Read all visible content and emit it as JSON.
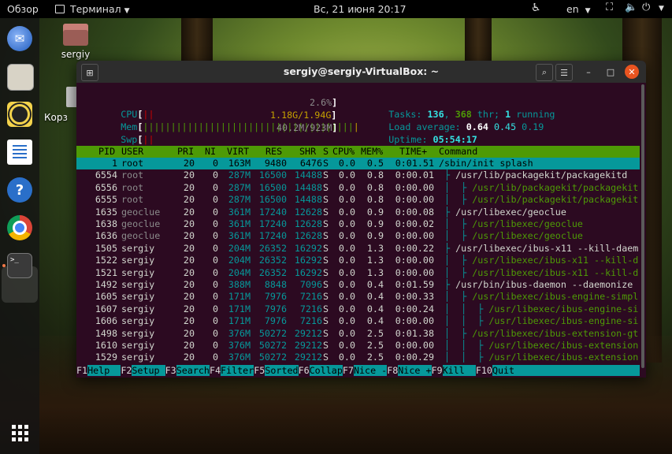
{
  "topbar": {
    "activities": "Обзор",
    "app_menu": "Терминал",
    "clock": "Вс, 21 июня  20:17",
    "language": "en"
  },
  "desktop": {
    "home_label": "sergiy",
    "trash_label": "Корз"
  },
  "window": {
    "title": "sergiy@sergiy-VirtualBox: ~"
  },
  "htop": {
    "meters": {
      "cpu_label": "CPU",
      "cpu_bar": "||",
      "cpu_value": "2.6%",
      "mem_label": "Mem",
      "mem_bar": "||||||||||||||||||||||||||||||||||||||",
      "mem_value": "1.18G/1.94G",
      "swp_label": "Swp",
      "swp_bar": "||",
      "swp_value": "40.2M/923M"
    },
    "summary": {
      "tasks_label": "Tasks:",
      "tasks": "136",
      "thr": "368",
      "thr_label": "thr;",
      "running": "1",
      "running_label": "running",
      "load_label": "Load average:",
      "load1": "0.64",
      "load5": "0.45",
      "load15": "0.19",
      "uptime_label": "Uptime:",
      "uptime": "05:54:17"
    },
    "header": [
      "PID",
      "USER",
      "PRI",
      "NI",
      "VIRT",
      "RES",
      "SHR",
      "S",
      "CPU%",
      "MEM%",
      "TIME+",
      "Command"
    ],
    "rows": [
      {
        "pid": "1",
        "user": "root",
        "pri": "20",
        "ni": "0",
        "virt": "163M",
        "res": "9480",
        "shr": "6476",
        "s": "S",
        "cpu": "0.0",
        "mem": "0.5",
        "time": "0:01.51",
        "cmd": "/sbin/init splash",
        "depth": 0,
        "dim": false,
        "selected": true
      },
      {
        "pid": "6554",
        "user": "root",
        "pri": "20",
        "ni": "0",
        "virt": "287M",
        "res": "16500",
        "shr": "14488",
        "s": "S",
        "cpu": "0.0",
        "mem": "0.8",
        "time": "0:00.01",
        "cmd": "/usr/lib/packagekit/packagekitd",
        "depth": 1,
        "dim": true,
        "selected": false
      },
      {
        "pid": "6556",
        "user": "root",
        "pri": "20",
        "ni": "0",
        "virt": "287M",
        "res": "16500",
        "shr": "14488",
        "s": "S",
        "cpu": "0.0",
        "mem": "0.8",
        "time": "0:00.00",
        "cmd": "/usr/lib/packagekit/packagekit",
        "depth": 2,
        "dim": true,
        "selected": false
      },
      {
        "pid": "6555",
        "user": "root",
        "pri": "20",
        "ni": "0",
        "virt": "287M",
        "res": "16500",
        "shr": "14488",
        "s": "S",
        "cpu": "0.0",
        "mem": "0.8",
        "time": "0:00.00",
        "cmd": "/usr/lib/packagekit/packagekit",
        "depth": 2,
        "dim": true,
        "selected": false
      },
      {
        "pid": "1635",
        "user": "geoclue",
        "pri": "20",
        "ni": "0",
        "virt": "361M",
        "res": "17240",
        "shr": "12628",
        "s": "S",
        "cpu": "0.0",
        "mem": "0.9",
        "time": "0:00.08",
        "cmd": "/usr/libexec/geoclue",
        "depth": 1,
        "dim": true,
        "selected": false
      },
      {
        "pid": "1638",
        "user": "geoclue",
        "pri": "20",
        "ni": "0",
        "virt": "361M",
        "res": "17240",
        "shr": "12628",
        "s": "S",
        "cpu": "0.0",
        "mem": "0.9",
        "time": "0:00.02",
        "cmd": "/usr/libexec/geoclue",
        "depth": 2,
        "dim": true,
        "selected": false
      },
      {
        "pid": "1636",
        "user": "geoclue",
        "pri": "20",
        "ni": "0",
        "virt": "361M",
        "res": "17240",
        "shr": "12628",
        "s": "S",
        "cpu": "0.0",
        "mem": "0.9",
        "time": "0:00.00",
        "cmd": "/usr/libexec/geoclue",
        "depth": 2,
        "dim": true,
        "selected": false
      },
      {
        "pid": "1505",
        "user": "sergiy",
        "pri": "20",
        "ni": "0",
        "virt": "204M",
        "res": "26352",
        "shr": "16292",
        "s": "S",
        "cpu": "0.0",
        "mem": "1.3",
        "time": "0:00.22",
        "cmd": "/usr/libexec/ibus-x11 --kill-daem",
        "depth": 1,
        "dim": false,
        "selected": false
      },
      {
        "pid": "1522",
        "user": "sergiy",
        "pri": "20",
        "ni": "0",
        "virt": "204M",
        "res": "26352",
        "shr": "16292",
        "s": "S",
        "cpu": "0.0",
        "mem": "1.3",
        "time": "0:00.00",
        "cmd": "/usr/libexec/ibus-x11 --kill-d",
        "depth": 2,
        "dim": false,
        "selected": false
      },
      {
        "pid": "1521",
        "user": "sergiy",
        "pri": "20",
        "ni": "0",
        "virt": "204M",
        "res": "26352",
        "shr": "16292",
        "s": "S",
        "cpu": "0.0",
        "mem": "1.3",
        "time": "0:00.00",
        "cmd": "/usr/libexec/ibus-x11 --kill-d",
        "depth": 2,
        "dim": false,
        "selected": false
      },
      {
        "pid": "1492",
        "user": "sergiy",
        "pri": "20",
        "ni": "0",
        "virt": "388M",
        "res": "8848",
        "shr": "7096",
        "s": "S",
        "cpu": "0.0",
        "mem": "0.4",
        "time": "0:01.59",
        "cmd": "/usr/bin/ibus-daemon --daemonize",
        "depth": 1,
        "dim": false,
        "selected": false
      },
      {
        "pid": "1605",
        "user": "sergiy",
        "pri": "20",
        "ni": "0",
        "virt": "171M",
        "res": "7976",
        "shr": "7216",
        "s": "S",
        "cpu": "0.0",
        "mem": "0.4",
        "time": "0:00.33",
        "cmd": "/usr/libexec/ibus-engine-simpl",
        "depth": 2,
        "dim": false,
        "selected": false
      },
      {
        "pid": "1607",
        "user": "sergiy",
        "pri": "20",
        "ni": "0",
        "virt": "171M",
        "res": "7976",
        "shr": "7216",
        "s": "S",
        "cpu": "0.0",
        "mem": "0.4",
        "time": "0:00.24",
        "cmd": "/usr/libexec/ibus-engine-si",
        "depth": 3,
        "dim": false,
        "selected": false
      },
      {
        "pid": "1606",
        "user": "sergiy",
        "pri": "20",
        "ni": "0",
        "virt": "171M",
        "res": "7976",
        "shr": "7216",
        "s": "S",
        "cpu": "0.0",
        "mem": "0.4",
        "time": "0:00.00",
        "cmd": "/usr/libexec/ibus-engine-si",
        "depth": 3,
        "dim": false,
        "selected": false
      },
      {
        "pid": "1498",
        "user": "sergiy",
        "pri": "20",
        "ni": "0",
        "virt": "376M",
        "res": "50272",
        "shr": "29212",
        "s": "S",
        "cpu": "0.0",
        "mem": "2.5",
        "time": "0:01.38",
        "cmd": "/usr/libexec/ibus-extension-gt",
        "depth": 2,
        "dim": false,
        "selected": false
      },
      {
        "pid": "1610",
        "user": "sergiy",
        "pri": "20",
        "ni": "0",
        "virt": "376M",
        "res": "50272",
        "shr": "29212",
        "s": "S",
        "cpu": "0.0",
        "mem": "2.5",
        "time": "0:00.00",
        "cmd": "/usr/libexec/ibus-extension",
        "depth": 3,
        "dim": false,
        "selected": false
      },
      {
        "pid": "1529",
        "user": "sergiy",
        "pri": "20",
        "ni": "0",
        "virt": "376M",
        "res": "50272",
        "shr": "29212",
        "s": "S",
        "cpu": "0.0",
        "mem": "2.5",
        "time": "0:00.29",
        "cmd": "/usr/libexec/ibus-extension",
        "depth": 3,
        "dim": false,
        "selected": false
      }
    ],
    "function_keys": [
      {
        "key": "F1",
        "label": "Help  "
      },
      {
        "key": "F2",
        "label": "Setup "
      },
      {
        "key": "F3",
        "label": "Search"
      },
      {
        "key": "F4",
        "label": "Filter"
      },
      {
        "key": "F5",
        "label": "Sorted"
      },
      {
        "key": "F6",
        "label": "Collap"
      },
      {
        "key": "F7",
        "label": "Nice -"
      },
      {
        "key": "F8",
        "label": "Nice +"
      },
      {
        "key": "F9",
        "label": "Kill  "
      },
      {
        "key": "F10",
        "label": "Quit                         "
      }
    ]
  },
  "colors": {
    "terminal_bg": "#2c0a21",
    "header_bg": "#4e9a06",
    "selected_bg": "#06989a",
    "cyan": "#06989a",
    "green": "#4e9a06",
    "red": "#cc0000",
    "dim": "#8b8b8b",
    "bright_cyan": "#34e2e2"
  },
  "icons": {
    "dock": [
      "thunderbird-icon",
      "files-icon",
      "rhythmbox-icon",
      "writer-icon",
      "help-icon",
      "chrome-icon",
      "terminal-icon",
      "app-grid-icon"
    ]
  }
}
